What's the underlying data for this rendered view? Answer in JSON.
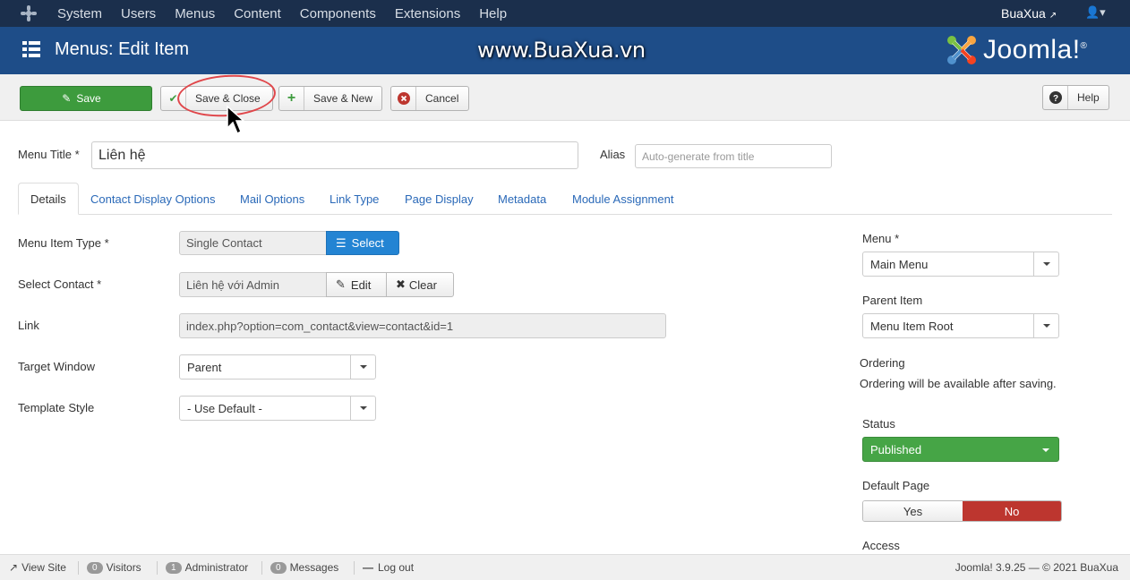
{
  "navbar": {
    "items": [
      "System",
      "Users",
      "Menus",
      "Content",
      "Components",
      "Extensions",
      "Help"
    ],
    "user": "BuaXua"
  },
  "header": {
    "title": "Menus: Edit Item",
    "watermark": "www.BuaXua.vn",
    "brand": "Joomla!",
    "brand_reg": "®"
  },
  "toolbar": {
    "save": "Save",
    "save_close": "Save & Close",
    "save_new": "Save & New",
    "cancel": "Cancel",
    "help": "Help"
  },
  "form": {
    "menu_title_label": "Menu Title *",
    "menu_title_value": "Liên hệ",
    "alias_label": "Alias",
    "alias_placeholder": "Auto-generate from title"
  },
  "tabs": [
    "Details",
    "Contact Display Options",
    "Mail Options",
    "Link Type",
    "Page Display",
    "Metadata",
    "Module Assignment"
  ],
  "details": {
    "menu_item_type_label": "Menu Item Type *",
    "menu_item_type_value": "Single Contact",
    "select_button": "Select",
    "select_contact_label": "Select Contact *",
    "select_contact_value": "Liên hệ với Admin",
    "edit_button": "Edit",
    "clear_button": "Clear",
    "link_label": "Link",
    "link_value": "index.php?option=com_contact&view=contact&id=1",
    "target_window_label": "Target Window",
    "target_window_value": "Parent",
    "template_style_label": "Template Style",
    "template_style_value": "- Use Default -"
  },
  "sidebar": {
    "menu_label": "Menu *",
    "menu_value": "Main Menu",
    "parent_label": "Parent Item",
    "parent_value": "Menu Item Root",
    "ordering_label": "Ordering",
    "ordering_note": "Ordering will be available after saving.",
    "status_label": "Status",
    "status_value": "Published",
    "default_page_label": "Default Page",
    "yes": "Yes",
    "no": "No",
    "access_label": "Access"
  },
  "footer": {
    "view_site": "View Site",
    "visitors_count": "0",
    "visitors": "Visitors",
    "admin_count": "1",
    "administrator": "Administrator",
    "messages_count": "0",
    "messages": "Messages",
    "logout": "Log out",
    "copyright": "Joomla! 3.9.25 — © 2021 BuaXua"
  },
  "colors": {
    "navbar": "#1b2f4c",
    "header": "#1e4d88",
    "save_green": "#3d9b3d",
    "select_blue": "#2384d3",
    "status_green": "#46a546",
    "no_red": "#bd362f"
  }
}
